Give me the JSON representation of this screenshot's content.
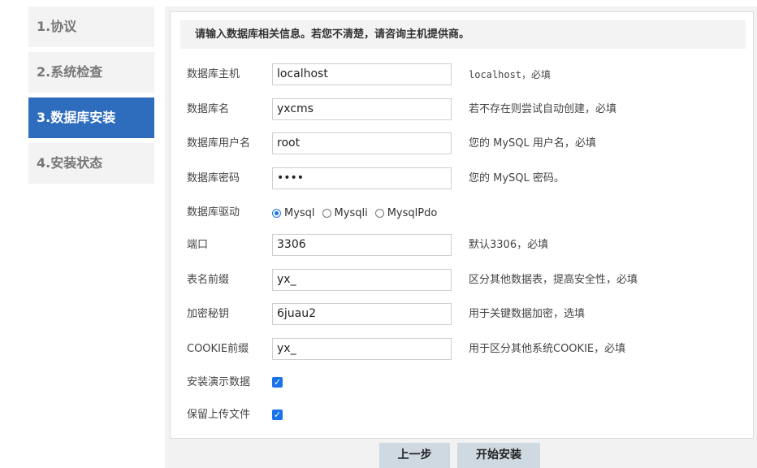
{
  "steps": [
    {
      "label": "1.协议"
    },
    {
      "label": "2.系统检查"
    },
    {
      "label": "3.数据库安装"
    },
    {
      "label": "4.安装状态"
    }
  ],
  "notice": "请输入数据库相关信息。若您不清楚，请咨询主机提供商。",
  "fields": {
    "host": {
      "label": "数据库主机",
      "value": "localhost",
      "hint": "localhost，必填"
    },
    "name": {
      "label": "数据库名",
      "value": "yxcms",
      "hint": "若不存在则尝试自动创建，必填"
    },
    "user": {
      "label": "数据库用户名",
      "value": "root",
      "hint": "您的 MySQL 用户名，必填"
    },
    "password": {
      "label": "数据库密码",
      "value": "••••",
      "hint": "您的 MySQL 密码。"
    },
    "driver": {
      "label": "数据库驱动",
      "options": [
        "Mysql",
        "Mysqli",
        "MysqlPdo"
      ],
      "selected": "Mysql"
    },
    "port": {
      "label": "端口",
      "value": "3306",
      "hint": "默认3306，必填"
    },
    "prefix": {
      "label": "表名前缀",
      "value": "yx_",
      "hint": "区分其他数据表，提高安全性，必填"
    },
    "secret": {
      "label": "加密秘钥",
      "value": "6juau2",
      "hint": "用于关键数据加密，选填"
    },
    "cookie": {
      "label": "COOKIE前缀",
      "value": "yx_",
      "hint": "用于区分其他系统COOKIE，必填"
    },
    "demo": {
      "label": "安装演示数据",
      "checked": true
    },
    "keep_uploads": {
      "label": "保留上传文件",
      "checked": true
    }
  },
  "buttons": {
    "prev": "上一步",
    "install": "开始安装"
  }
}
